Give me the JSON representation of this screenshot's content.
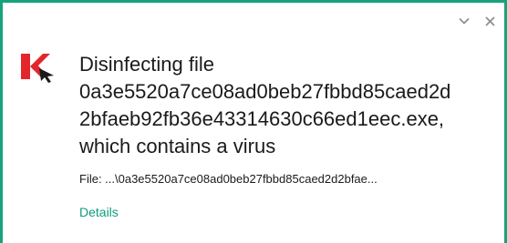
{
  "window": {
    "accent_color": "#16a37c",
    "controls": {
      "collapse_icon": "chevron-down-icon",
      "close_icon": "close-icon"
    }
  },
  "notification": {
    "logo_icon": "kaspersky-logo-icon",
    "title_lines": [
      "Disinfecting file",
      "0a3e5520a7ce08ad0beb27fbbd85caed2d",
      "2bfaeb92fb36e43314630c66ed1eec.exe,",
      "which contains a virus"
    ],
    "file_label": "File: ...\\0a3e5520a7ce08ad0beb27fbbd85caed2d2bfae...",
    "details_label": "Details",
    "link_color": "#0f9b80"
  }
}
